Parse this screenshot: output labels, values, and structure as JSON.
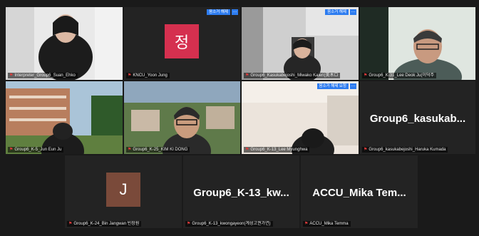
{
  "participants": [
    {
      "tag": "Interpreter_Group6_Suan_Ehko",
      "interp": false
    },
    {
      "tag": "KNCU_Yoon Jung",
      "avatar_letter": "정",
      "avatar_color": "#d5304f",
      "interp": true
    },
    {
      "tag": "Group6_Kasukabejoshi_Miwako Kaieri(美木ロ",
      "interp": true
    },
    {
      "tag": "Group6_K-31_Lee Deok Ju(이덕주",
      "interp": false
    },
    {
      "tag": "Group6_K-5_Jun Eun Ju",
      "interp": false
    },
    {
      "tag": "Group6_K-25_KIM KI DONG",
      "interp": false
    },
    {
      "tag": "Group6_K-13_Lee Myunghwa",
      "interp": true
    },
    {
      "tag": "Group6_kasukabejoshi_Haruka Kumada",
      "display_name": "Group6_kasukab...",
      "interp": false
    },
    {
      "tag": "Group6_K-24_Bin Jangwan 빈장원",
      "avatar_letter": "J",
      "avatar_color": "#7a4a3a",
      "interp": false
    },
    {
      "tag": "Group6_K-13_kwongayeon(계성고권가연)",
      "display_name": "Group6_K-13_kw...",
      "interp": false
    },
    {
      "tag": "ACCU_Mika Temma",
      "display_name": "ACCU_Mika Tem...",
      "interp": false
    }
  ],
  "labels": {
    "interp_badge": "음소거 해제",
    "interp_badge_alt": "음소거 해제 요청",
    "more": "…"
  },
  "colors": {
    "background": "#1b1b1b",
    "tile": "#232323",
    "active_border": "#d9e66a",
    "badge_blue": "#2d7cf0",
    "mic_red": "#e23b3b"
  }
}
